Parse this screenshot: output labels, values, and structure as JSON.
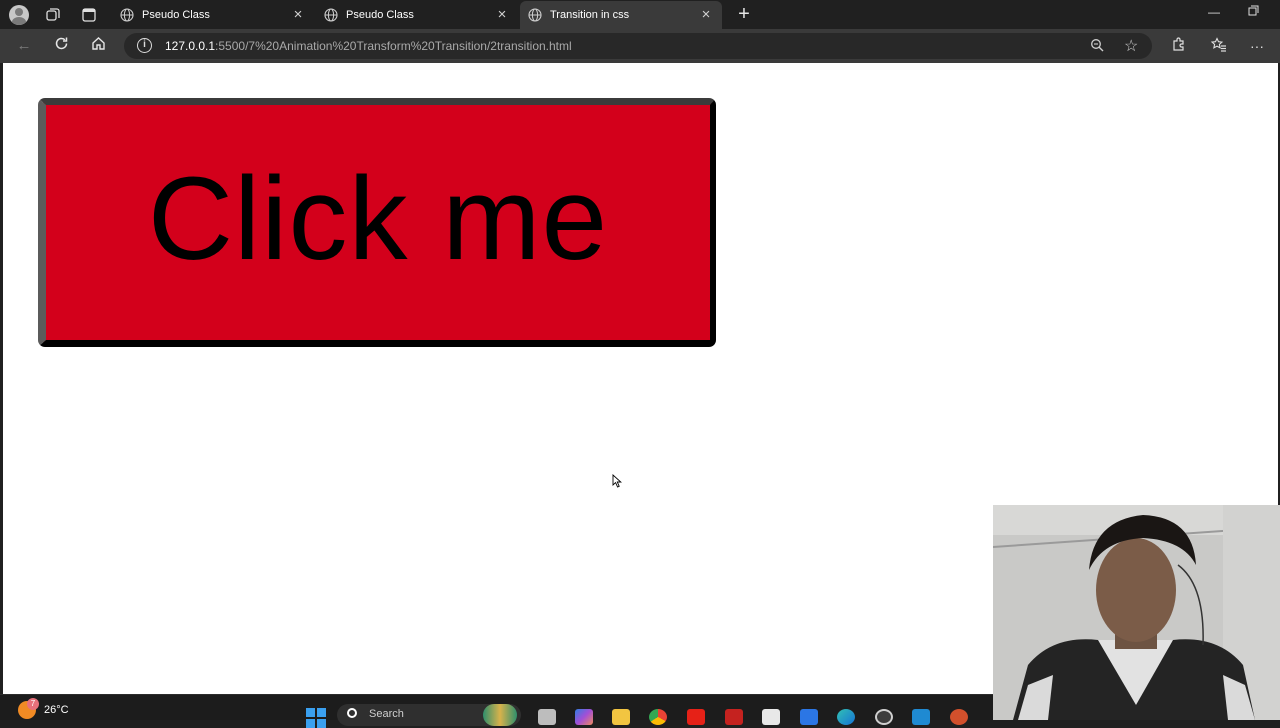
{
  "browser": {
    "tabs": [
      {
        "title": "Pseudo Class",
        "active": false
      },
      {
        "title": "Pseudo Class",
        "active": false
      },
      {
        "title": "Transition in css",
        "active": true
      }
    ],
    "address": {
      "host": "127.0.0.1",
      "path": ":5500/7%20Animation%20Transform%20Transition/2transition.html"
    }
  },
  "page": {
    "button_label": "Click me",
    "button_color": "#d3001b"
  },
  "taskbar": {
    "weather_temp": "26°C",
    "weather_badge": "7",
    "search_label": "Search",
    "apps": [
      "file-explorer",
      "copilot",
      "folder",
      "chrome",
      "youtube",
      "gmail",
      "store",
      "vscode-alt",
      "edge",
      "settings",
      "vscode",
      "powerpoint"
    ]
  },
  "icons": {
    "tab_favicon": "globe-icon",
    "tab_close": "close-icon",
    "new_tab": "plus-icon"
  }
}
